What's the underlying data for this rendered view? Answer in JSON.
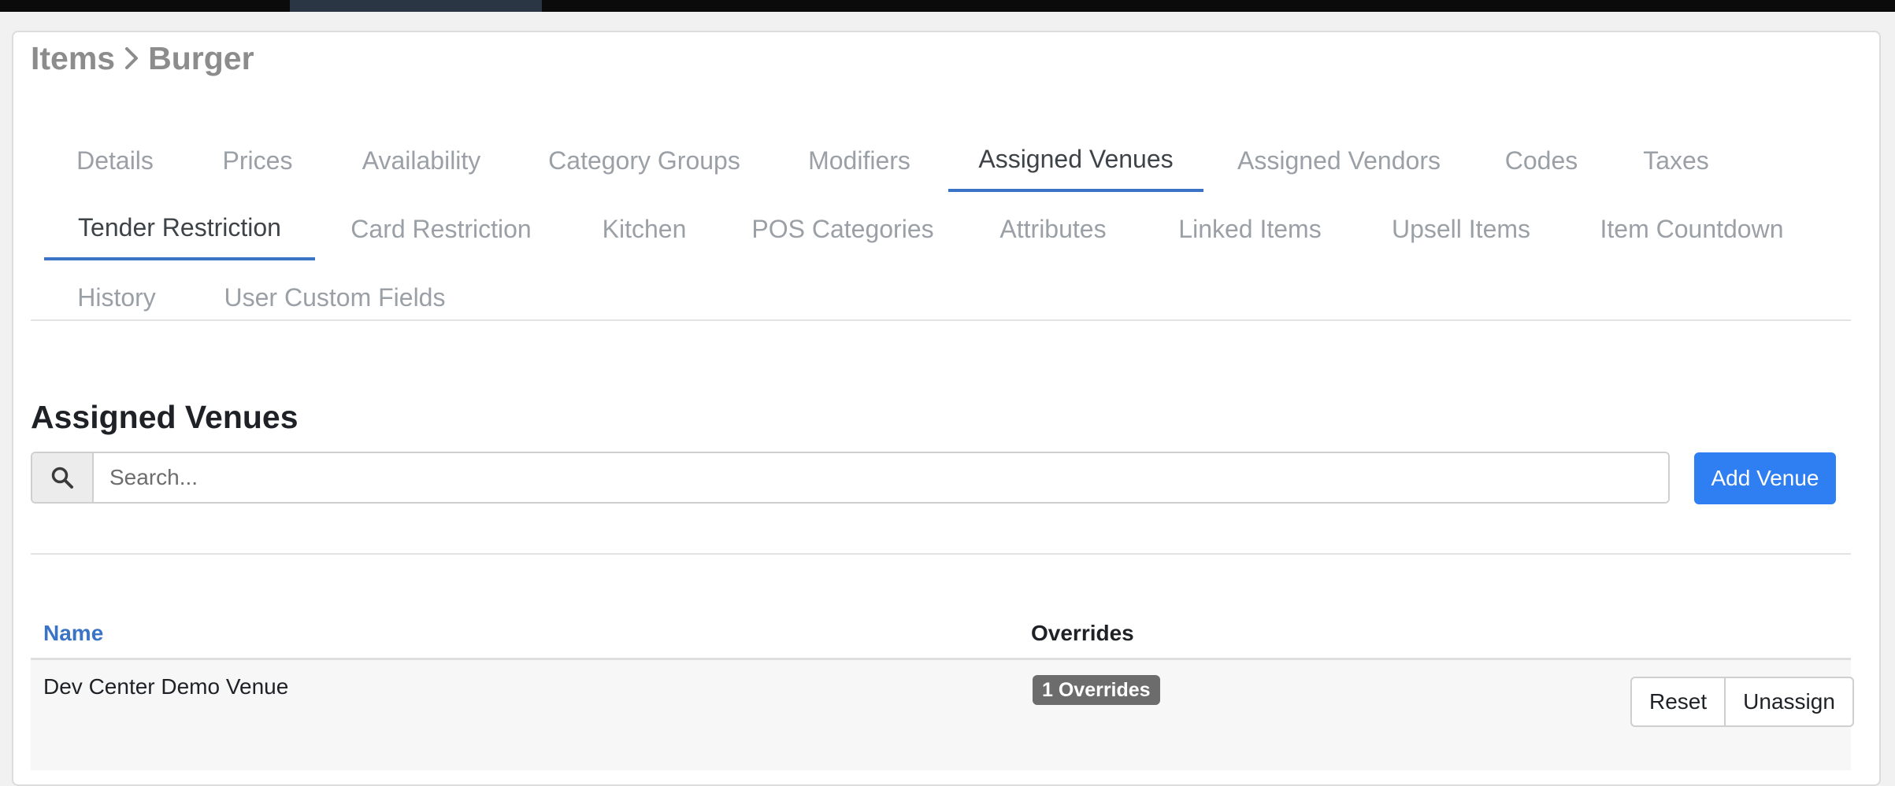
{
  "breadcrumb": {
    "parent": "Items",
    "current": "Burger"
  },
  "tabs": [
    {
      "label": "Details"
    },
    {
      "label": "Prices"
    },
    {
      "label": "Availability"
    },
    {
      "label": "Category Groups"
    },
    {
      "label": "Modifiers"
    },
    {
      "label": "Assigned Venues",
      "active": true
    },
    {
      "label": "Assigned Vendors"
    },
    {
      "label": "Codes"
    },
    {
      "label": "Taxes"
    },
    {
      "label": "Tender Restriction",
      "active": true
    },
    {
      "label": "Card Restriction"
    },
    {
      "label": "Kitchen"
    },
    {
      "label": "POS Categories"
    },
    {
      "label": "Attributes"
    },
    {
      "label": "Linked Items"
    },
    {
      "label": "Upsell Items"
    },
    {
      "label": "Item Countdown"
    },
    {
      "label": "History"
    },
    {
      "label": "User Custom Fields"
    }
  ],
  "section": {
    "title": "Assigned Venues"
  },
  "search": {
    "placeholder": "Search...",
    "value": ""
  },
  "add_button_label": "Add Venue",
  "table": {
    "columns": {
      "name": "Name",
      "overrides": "Overrides"
    },
    "rows": [
      {
        "name": "Dev Center Demo Venue",
        "overrides_badge": "1 Overrides",
        "actions": {
          "reset": "Reset",
          "unassign": "Unassign"
        }
      }
    ]
  },
  "colors": {
    "accent": "#3b73c6",
    "primary_button": "#2f7ef2",
    "badge": "#6c6c6c",
    "top_bar": "#0b0b0b"
  },
  "icons": {
    "breadcrumb_separator": "chevron-right-icon",
    "search": "search-icon"
  }
}
